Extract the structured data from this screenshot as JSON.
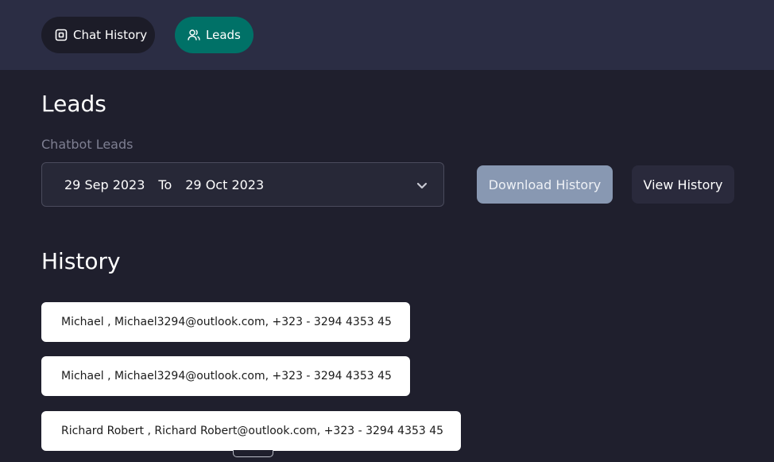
{
  "tabs": [
    {
      "label": "Chat History",
      "icon": "chat-square-icon",
      "active": false
    },
    {
      "label": "Leads",
      "icon": "users-icon",
      "active": true
    }
  ],
  "page": {
    "title": "Leads",
    "subtitle": "Chatbot Leads"
  },
  "date_range": {
    "from": "29 Sep 2023",
    "separator": "To",
    "to": "29 Oct 2023"
  },
  "actions": {
    "download_label": "Download History",
    "view_label": "View History"
  },
  "history": {
    "title": "History",
    "items": [
      "Michael , Michael3294@outlook.com, +323 - 3294 4353 45",
      "Michael , Michael3294@outlook.com, +323 - 3294 4353 45",
      "Richard Robert , Richard Robert@outlook.com, +323 - 3294 4353 45"
    ]
  },
  "colors": {
    "background": "#1f1f2d",
    "topbar": "#2b2d44",
    "active_tab": "#007167",
    "download_button": "#8898b2"
  }
}
